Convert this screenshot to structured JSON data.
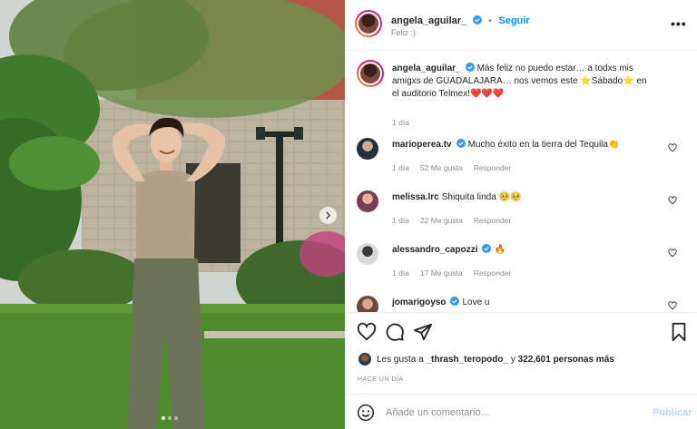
{
  "post": {
    "author": "angela_aguilar_",
    "follow_label": "Seguir",
    "location": "Feliz :)",
    "more_label": "•••"
  },
  "caption": {
    "username": "angela_aguilar_",
    "text": "Más feliz no puedo estar… a todxs mis amigxs de GUADALAJARA… nos vemos este ⭐Sábado⭐ en el auditorio Telmex!❤️❤️❤️",
    "time": "1 día"
  },
  "comments": [
    {
      "username": "marioperea.tv",
      "text": "Mucho éxito en la tierra del Tequila👏",
      "time": "1 día",
      "likes": "52 Me gusta",
      "reply": "Responder"
    },
    {
      "username": "melissa.lrc",
      "text": "Shiquita linda 🥺🥺",
      "time": "1 día",
      "likes": "22 Me gusta",
      "reply": "Responder"
    },
    {
      "username": "alessandro_capozzi",
      "text": "🔥",
      "time": "1 día",
      "likes": "17 Me gusta",
      "reply": "Responder"
    },
    {
      "username": "jomarigoyso",
      "text": "Love u",
      "time": "",
      "likes": "",
      "reply": ""
    }
  ],
  "likes": {
    "prefix": "Les gusta a",
    "user": "_thrash_teropodo_",
    "middle": "y",
    "count": "322,601 personas más"
  },
  "time_ago": "HACE UN DÍA",
  "add_comment": {
    "placeholder": "Añade un comentario...",
    "post_label": "Publicar"
  },
  "icons": {
    "like": "heart-icon",
    "comment": "comment-icon",
    "share": "share-icon",
    "save": "bookmark-icon",
    "emoji": "emoji-icon",
    "verified": "verified-badge-icon"
  },
  "colors": {
    "accent": "#0095f6",
    "verified": "#3897f0",
    "post_disabled": "#b3dbff"
  },
  "carousel": {
    "current": 1,
    "total": 3
  }
}
